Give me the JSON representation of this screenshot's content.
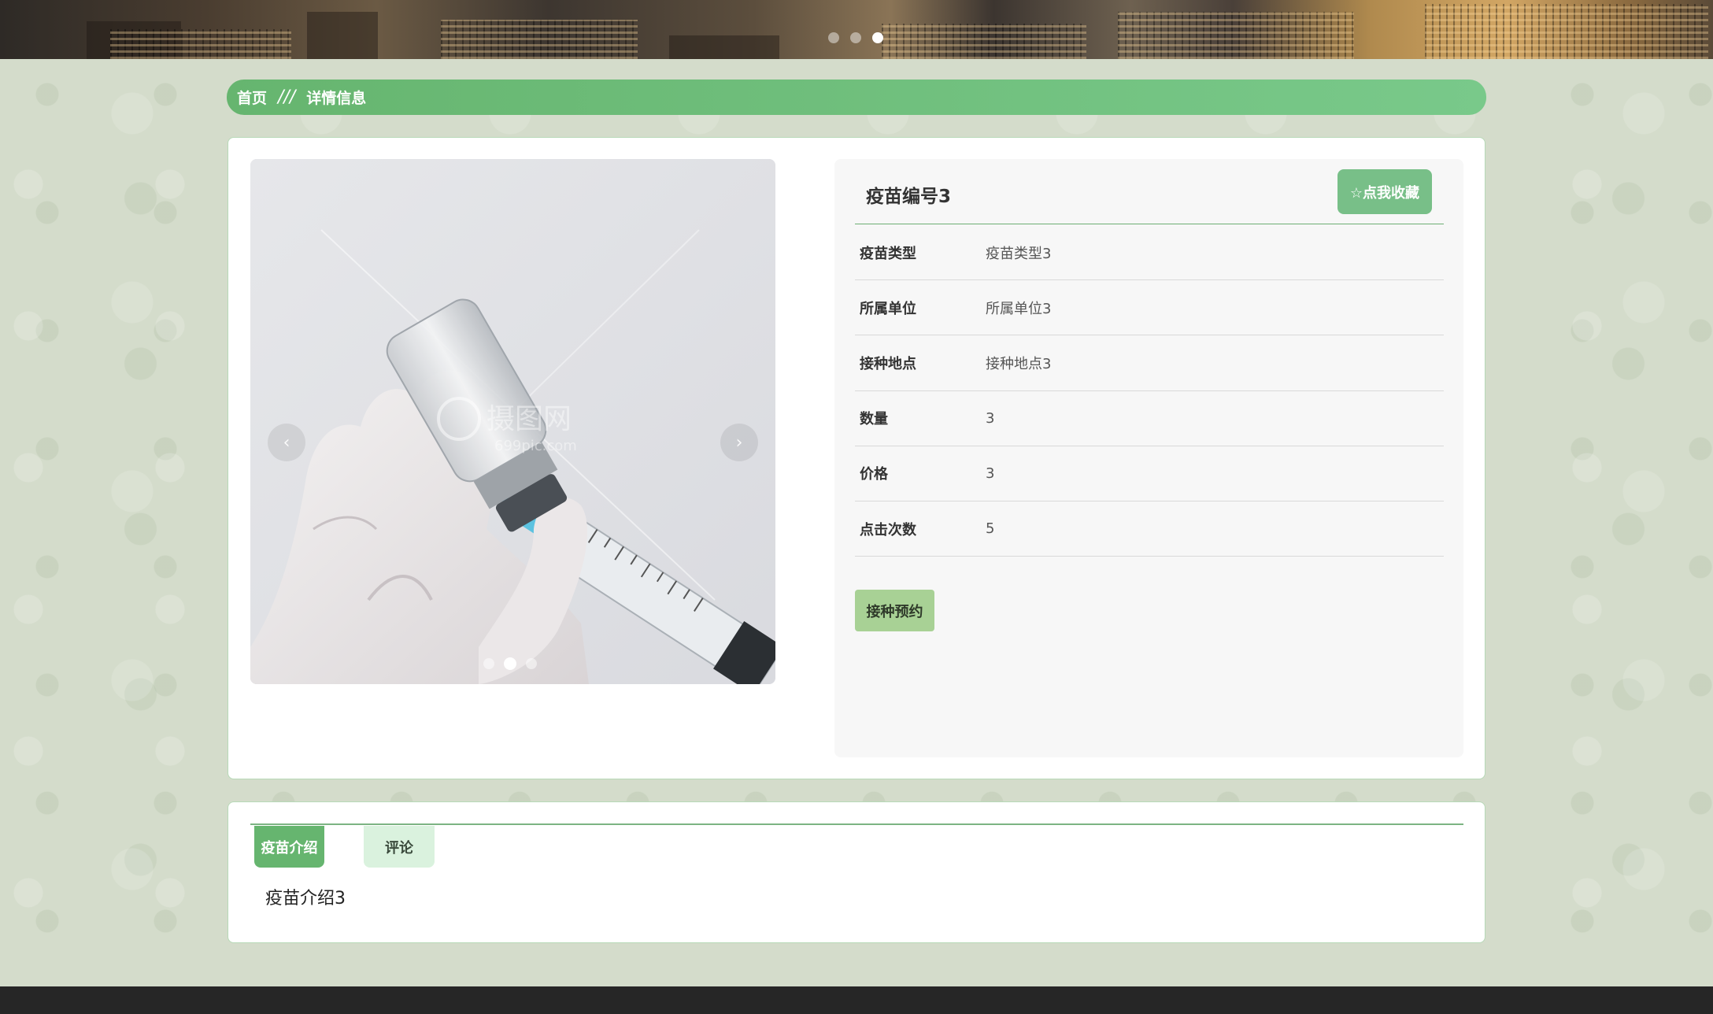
{
  "banner": {
    "dots": [
      false,
      false,
      true
    ]
  },
  "breadcrumb": {
    "home": "首页",
    "separator": "///",
    "current": "详情信息"
  },
  "carousel": {
    "prev_icon": "chevron-left-icon",
    "next_icon": "chevron-right-icon",
    "prev_glyph": "‹",
    "next_glyph": "›",
    "watermark_text": "摄图网",
    "watermark_sub": "699pic.com",
    "dots": [
      false,
      true,
      false
    ]
  },
  "detail": {
    "title": "疫苗编号3",
    "favorite_label": "☆点我收藏",
    "fields": [
      {
        "label": "疫苗类型",
        "value": "疫苗类型3"
      },
      {
        "label": "所属单位",
        "value": "所属单位3"
      },
      {
        "label": "接种地点",
        "value": "接种地点3"
      },
      {
        "label": "数量",
        "value": "3"
      },
      {
        "label": "价格",
        "value": "3"
      },
      {
        "label": "点击次数",
        "value": "5"
      }
    ],
    "reserve_label": "接种预约"
  },
  "tabs": {
    "items": [
      {
        "label": "疫苗介绍",
        "active": true
      },
      {
        "label": "评论",
        "active": false
      }
    ],
    "content": "疫苗介绍3"
  },
  "colors": {
    "accent": "#66b56f",
    "accent_light": "#79c98a",
    "favorite_button": "#78bf88",
    "reserve_button": "#a8d195",
    "tab_inactive": "#daf2de",
    "footer": "#262626"
  }
}
